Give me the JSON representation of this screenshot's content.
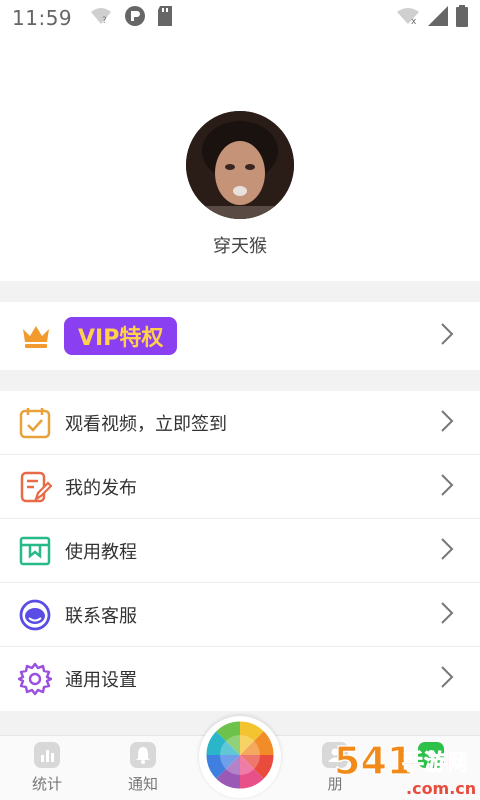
{
  "status_bar": {
    "time": "11:59",
    "left_icons": [
      "wifi-question-icon",
      "circle-app-icon",
      "sd-card-icon"
    ],
    "right_icons": [
      "wifi-off-icon",
      "signal-icon",
      "battery-icon"
    ]
  },
  "profile": {
    "username": "穿天猴"
  },
  "vip": {
    "label": "VIP特权"
  },
  "menu": {
    "items": [
      {
        "label": "观看视频，立即签到",
        "icon": "calendar-check-icon",
        "color": "#e8a13b"
      },
      {
        "label": "我的发布",
        "icon": "edit-note-icon",
        "color": "#e86a47"
      },
      {
        "label": "使用教程",
        "icon": "book-icon",
        "color": "#27b98a"
      },
      {
        "label": "联系客服",
        "icon": "headset-icon",
        "color": "#5a4de6"
      },
      {
        "label": "通用设置",
        "icon": "gear-icon",
        "color": "#9b4fe0"
      }
    ]
  },
  "tabbar": {
    "items": [
      {
        "label": "统计",
        "icon": "bar-chart-icon"
      },
      {
        "label": "通知",
        "icon": "bell-icon"
      },
      {
        "label": "",
        "icon": "color-wheel-icon"
      },
      {
        "label": "朋",
        "icon": "friends-icon"
      },
      {
        "label": "",
        "icon": "green-app-icon"
      }
    ]
  },
  "watermark": {
    "text": "54119手游网",
    "sub": ".com.cn"
  },
  "colors": {
    "vip_purple": "#8a3ff0",
    "vip_gold": "#ffd14a",
    "crown_orange": "#f39a2e",
    "divider": "#ececec"
  }
}
